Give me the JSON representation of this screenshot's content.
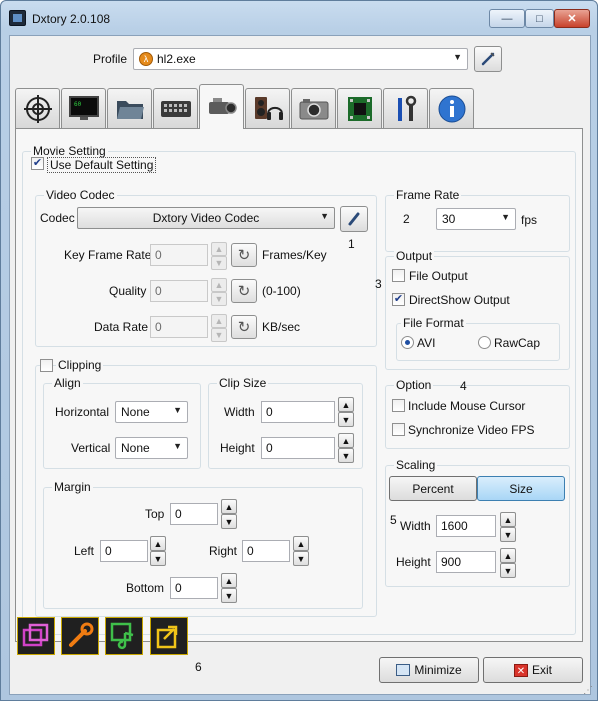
{
  "window": {
    "title": "Dxtory 2.0.108",
    "minimize_label": "—",
    "maximize_label": "□",
    "close_label": "✕"
  },
  "profile": {
    "label": "Profile",
    "value": "hl2.exe"
  },
  "tabs": [
    {
      "icon": "crosshair-icon"
    },
    {
      "icon": "monitor-icon"
    },
    {
      "icon": "folder-icon"
    },
    {
      "icon": "keyboard-icon"
    },
    {
      "icon": "video-camera-icon",
      "active": true
    },
    {
      "icon": "audio-icon"
    },
    {
      "icon": "photo-camera-icon"
    },
    {
      "icon": "chip-icon"
    },
    {
      "icon": "tools-icon"
    },
    {
      "icon": "info-icon"
    }
  ],
  "movie": {
    "group_title": "Movie Setting",
    "use_default_label": "Use Default Setting",
    "use_default_checked": true,
    "video_codec": {
      "title": "Video Codec",
      "codec_label": "Codec",
      "codec_value": "Dxtory Video Codec",
      "marker": "1",
      "key_frame_label": "Key Frame Rate",
      "key_frame_value": "0",
      "key_frame_unit": "Frames/Key",
      "quality_label": "Quality",
      "quality_value": "0",
      "quality_unit": "(0-100)",
      "data_rate_label": "Data Rate",
      "data_rate_value": "0",
      "data_rate_unit": "KB/sec"
    },
    "frame_rate": {
      "title": "Frame Rate",
      "marker": "2",
      "value": "30",
      "unit": "fps"
    },
    "output": {
      "title": "Output",
      "marker": "3",
      "file_output_label": "File Output",
      "file_output_checked": false,
      "directshow_label": "DirectShow Output",
      "directshow_checked": true,
      "file_format_title": "File Format",
      "avi_label": "AVI",
      "rawcap_label": "RawCap",
      "selected": "AVI"
    },
    "option": {
      "title": "Option",
      "marker": "4",
      "mouse_cursor_label": "Include Mouse Cursor",
      "sync_fps_label": "Synchronize Video FPS"
    },
    "scaling": {
      "title": "Scaling",
      "percent_label": "Percent",
      "size_label": "Size",
      "selected": "Size",
      "marker": "5",
      "width_label": "Width",
      "width_value": "1600",
      "height_label": "Height",
      "height_value": "900"
    },
    "clipping": {
      "label": "Clipping",
      "checked": false,
      "align": {
        "title": "Align",
        "horizontal_label": "Horizontal",
        "horizontal_value": "None",
        "vertical_label": "Vertical",
        "vertical_value": "None"
      },
      "clip_size": {
        "title": "Clip Size",
        "width_label": "Width",
        "width_value": "0",
        "height_label": "Height",
        "height_value": "0"
      },
      "margin": {
        "title": "Margin",
        "top_label": "Top",
        "top_value": "0",
        "left_label": "Left",
        "left_value": "0",
        "right_label": "Right",
        "right_value": "0",
        "bottom_label": "Bottom",
        "bottom_value": "0"
      }
    }
  },
  "footer": {
    "marker": "6",
    "minimize_label": "Minimize",
    "exit_label": "Exit"
  },
  "colors": {
    "accent_yellow": "#f0c419",
    "tab_selected_blue": "#a9d6f6"
  }
}
